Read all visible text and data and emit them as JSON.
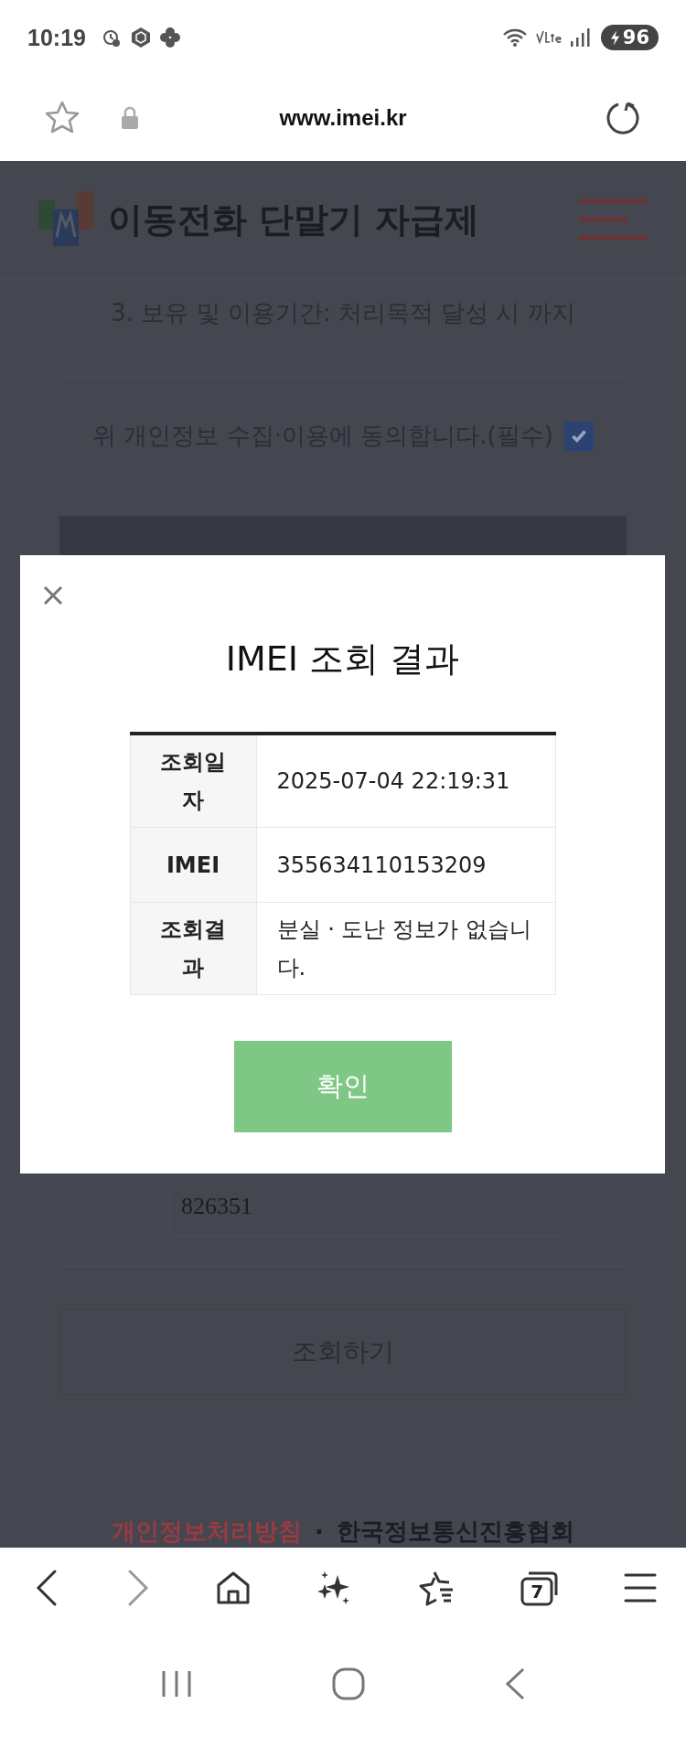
{
  "status_bar": {
    "time": "10:19",
    "battery": "96"
  },
  "address_bar": {
    "url": "www.imei.kr"
  },
  "page": {
    "site_title": "이동전화 단말기 자급제",
    "retention_text": "3. 보유 및 이용기간: 처리목적 달성 시 까지",
    "consent": {
      "label": "위 개인정보 수집·이용에 동의합니다.(필수)",
      "checked": true
    },
    "imei_input": {
      "value": "826351"
    },
    "lookup_button": "조회하기",
    "footer": {
      "privacy_link": "개인정보처리방침",
      "separator": "·",
      "org_name": "한국정보통신진흥협회"
    }
  },
  "modal": {
    "title": "IMEI 조회 결과",
    "rows": [
      {
        "label": "조회일자",
        "value": "2025-07-04 22:19:31"
      },
      {
        "label": "IMEI",
        "value": "355634110153209"
      },
      {
        "label": "조회결과",
        "value": "분실 · 도난 정보가 없습니다."
      }
    ],
    "confirm_button": "확인"
  },
  "browser_toolbar": {
    "tab_count": "7"
  }
}
